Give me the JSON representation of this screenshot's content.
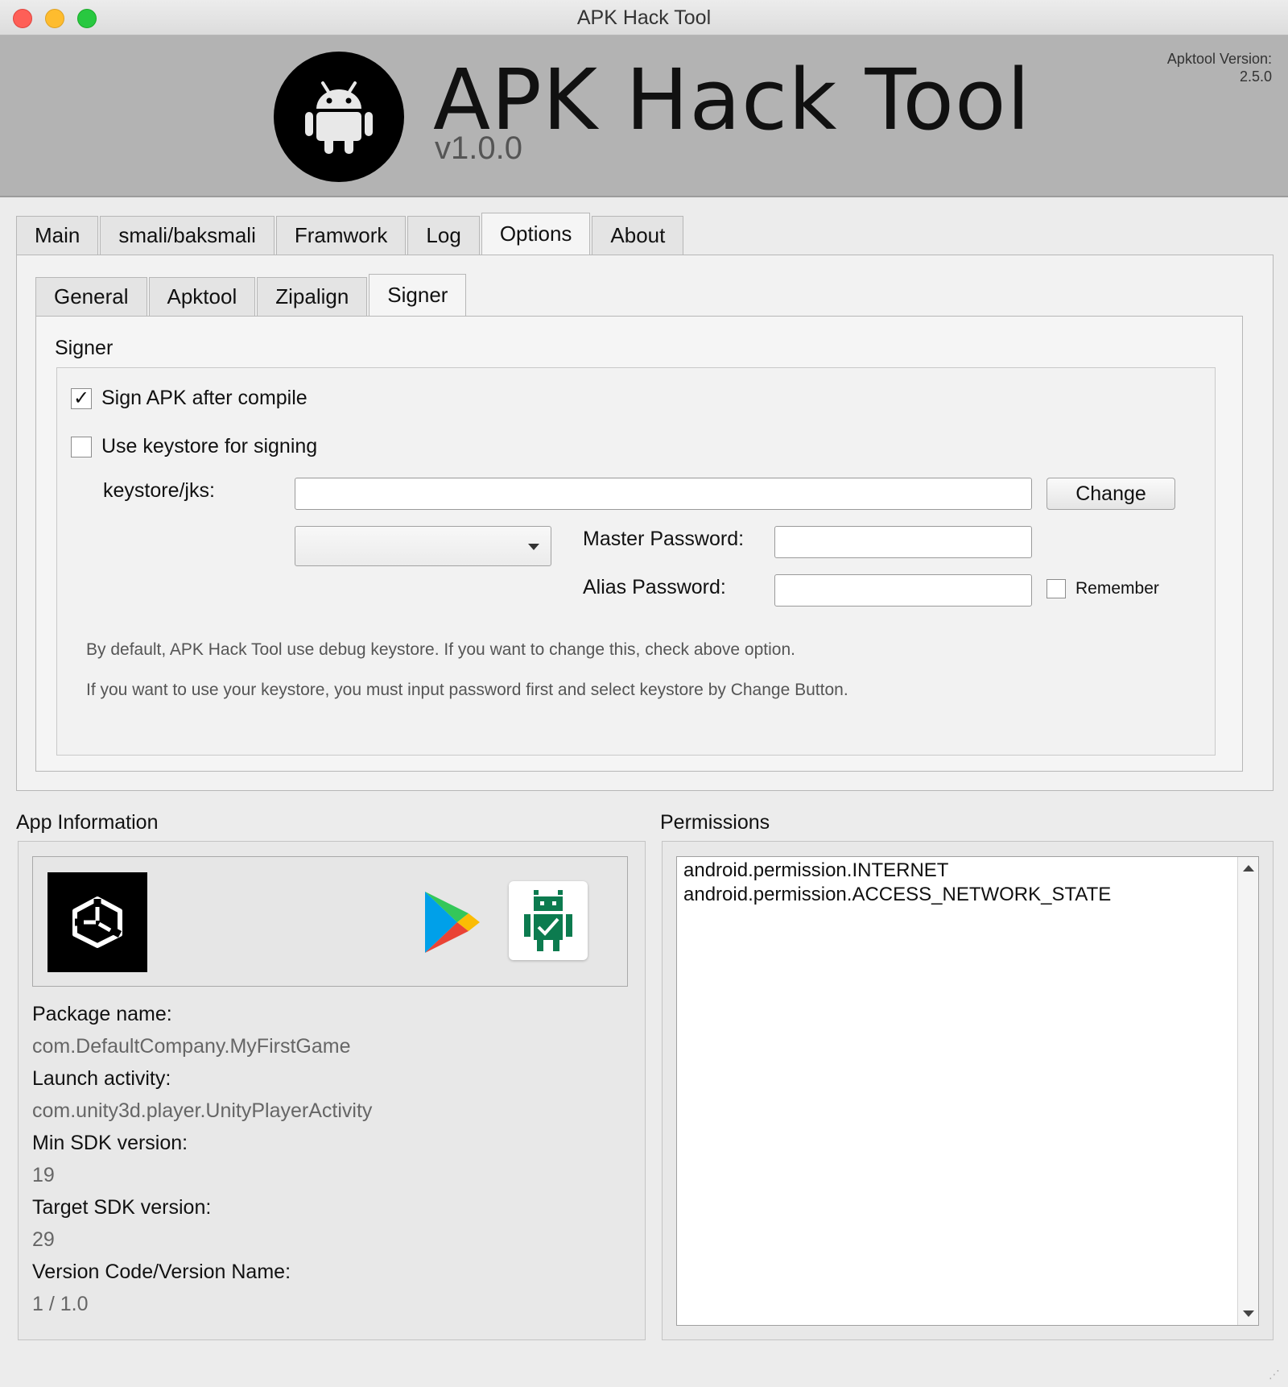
{
  "window": {
    "title": "APK Hack Tool"
  },
  "header": {
    "app_name": "APK Hack Tool",
    "version": "v1.0.0",
    "apktool_label": "Apktool Version:",
    "apktool_version": "2.5.0"
  },
  "main_tabs": [
    "Main",
    "smali/baksmali",
    "Framwork",
    "Log",
    "Options",
    "About"
  ],
  "main_tab_active": "Options",
  "options_tabs": [
    "General",
    "Apktool",
    "Zipalign",
    "Signer"
  ],
  "options_tab_active": "Signer",
  "signer": {
    "group_title": "Signer",
    "sign_after_compile": {
      "label": "Sign APK after compile",
      "checked": true,
      "mark": "✓"
    },
    "use_keystore": {
      "label": "Use keystore for signing",
      "checked": false
    },
    "keystore_label": "keystore/jks:",
    "keystore_value": "",
    "change_button": "Change",
    "alias_combo_value": "",
    "master_password_label": "Master Password:",
    "alias_password_label": "Alias Password:",
    "remember_label": "Remember",
    "hint_1": "By default, APK Hack Tool use debug keystore. If you want to change this, check above option.",
    "hint_2": "If you want to use your keystore, you must input password first and select keystore by Change Button."
  },
  "app_info": {
    "title": "App Information",
    "package_label": "Package name:",
    "package_value": "com.DefaultCompany.MyFirstGame",
    "launch_label": "Launch activity:",
    "launch_value": "com.unity3d.player.UnityPlayerActivity",
    "min_sdk_label": "Min SDK version:",
    "min_sdk_value": "19",
    "target_sdk_label": "Target SDK version:",
    "target_sdk_value": "29",
    "version_label": "Version Code/Version Name:",
    "version_value": "1 / 1.0"
  },
  "permissions": {
    "title": "Permissions",
    "items": [
      "android.permission.INTERNET",
      "android.permission.ACCESS_NETWORK_STATE"
    ]
  },
  "icons": {
    "android_logo": "android-icon",
    "unity_logo": "unity-icon",
    "play_store": "google-play-icon",
    "signer_app": "android-signer-icon"
  },
  "colors": {
    "banner_bg": "#b3b3b3",
    "signer_icon_green": "#0c7b4f"
  }
}
